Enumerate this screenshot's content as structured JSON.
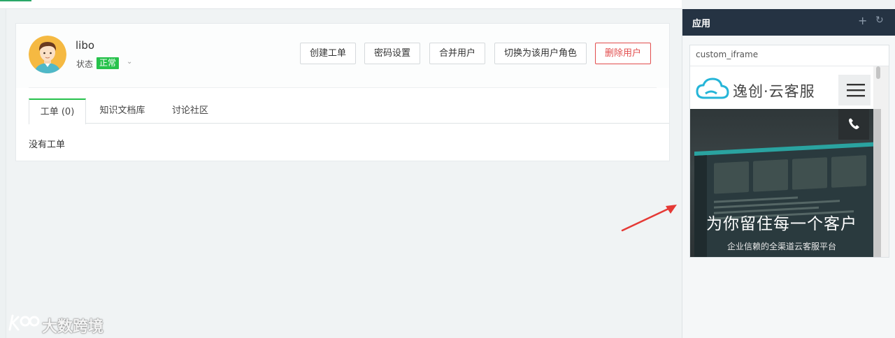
{
  "user": {
    "name": "libo",
    "status_label": "状态",
    "status_value": "正常"
  },
  "actions": {
    "create_ticket": "创建工单",
    "password_settings": "密码设置",
    "merge_user": "合并用户",
    "switch_role": "切换为该用户角色",
    "delete_user": "删除用户"
  },
  "tabs": [
    {
      "label": "工单 (0)",
      "active": true
    },
    {
      "label": "知识文档库",
      "active": false
    },
    {
      "label": "讨论社区",
      "active": false
    }
  ],
  "empty_text": "没有工单",
  "right_panel": {
    "title": "应用",
    "add_icon": "plus-icon",
    "refresh_icon": "refresh-icon",
    "app_name": "custom_iframe",
    "embedded": {
      "brand": "逸创·云客服",
      "hero_title": "为你留住每一个客户",
      "hero_subtitle": "企业信赖的全渠道云客服平台"
    }
  },
  "watermark": {
    "text": "大数跨境"
  },
  "colors": {
    "accent_green": "#27c24c",
    "danger_red": "#e24d4d",
    "panel_header": "#253343",
    "annotation_arrow": "#e53935"
  }
}
